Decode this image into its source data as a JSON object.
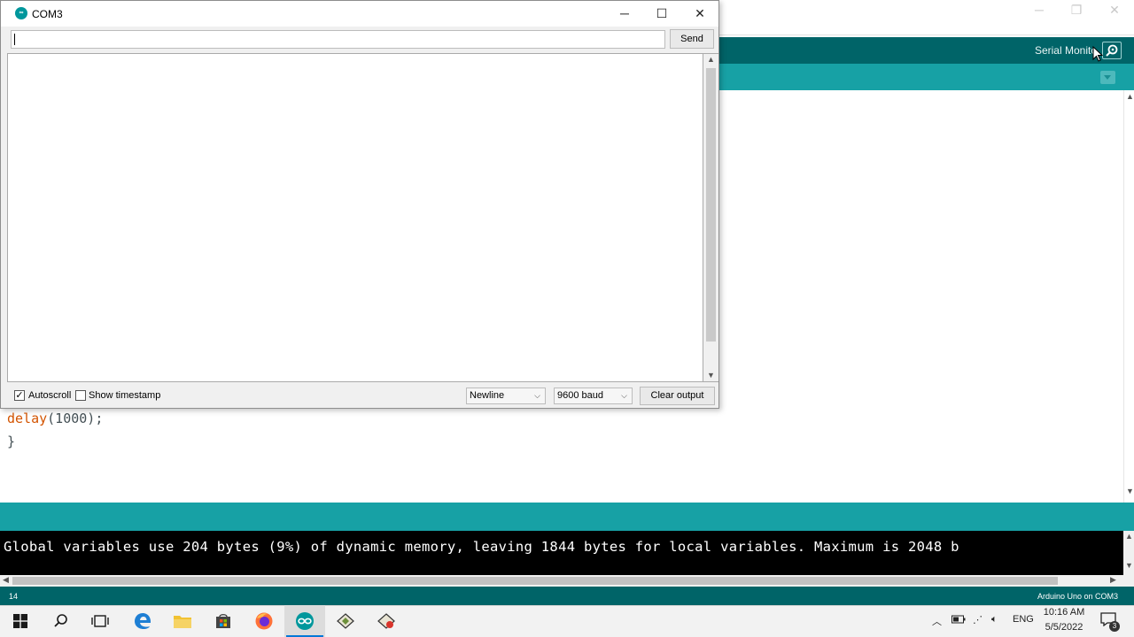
{
  "ide": {
    "serial_monitor_label": "Serial Monito",
    "code_lines": [
      {
        "keyword": "delay",
        "rest": "(1000);"
      },
      {
        "text": "}"
      }
    ],
    "console_text": "Global variables use 204 bytes (9%) of dynamic memory, leaving 1844 bytes for local variables. Maximum is 2048 b",
    "footer_line": "14",
    "footer_board": "Arduino Uno on COM3",
    "colors": {
      "toolbar": "#006468",
      "tabbar": "#17a1a5"
    }
  },
  "serial_monitor": {
    "title": "COM3",
    "input_value": "",
    "send_label": "Send",
    "autoscroll_label": "Autoscroll",
    "autoscroll_checked": true,
    "timestamp_label": "Show timestamp",
    "timestamp_checked": false,
    "line_ending": "Newline",
    "baud_rate": "9600 baud",
    "clear_label": "Clear output",
    "win_minimize": "─",
    "win_maximize": "☐",
    "win_close": "✕"
  },
  "taskbar": {
    "clock_time": "10:16 AM",
    "clock_date": "5/5/2022",
    "language": "ENG",
    "notification_count": "3",
    "icons": [
      "windows-start-icon",
      "search-icon",
      "task-view-icon",
      "edge-icon",
      "file-explorer-icon",
      "store-icon",
      "firefox-icon",
      "arduino-icon",
      "app-icon-1",
      "app-icon-2"
    ]
  }
}
